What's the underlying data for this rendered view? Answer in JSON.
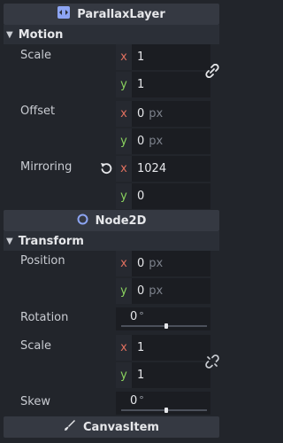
{
  "parallax_header": {
    "title": "ParallaxLayer"
  },
  "motion": {
    "section_label": "Motion",
    "scale": {
      "label": "Scale",
      "x_axis": "x",
      "x_value": "1",
      "y_axis": "y",
      "y_value": "1"
    },
    "offset": {
      "label": "Offset",
      "x_axis": "x",
      "x_value": "0",
      "y_axis": "y",
      "y_value": "0",
      "unit": "px"
    },
    "mirroring": {
      "label": "Mirroring",
      "x_axis": "x",
      "x_value": "1024",
      "y_axis": "y",
      "y_value": "0"
    }
  },
  "node2d_header": {
    "title": "Node2D"
  },
  "transform": {
    "section_label": "Transform",
    "position": {
      "label": "Position",
      "x_axis": "x",
      "x_value": "0",
      "y_axis": "y",
      "y_value": "0",
      "unit": "px"
    },
    "rotation": {
      "label": "Rotation",
      "value": "0",
      "unit": "°"
    },
    "scale": {
      "label": "Scale",
      "x_axis": "x",
      "x_value": "1",
      "y_axis": "y",
      "y_value": "1"
    },
    "skew": {
      "label": "Skew",
      "value": "0",
      "unit": "°"
    }
  },
  "canvasitem_header": {
    "title": "CanvasItem"
  },
  "colors": {
    "x_axis": "#e0705f",
    "y_axis": "#8ad35f",
    "node2d_icon": "#8da5f3"
  }
}
